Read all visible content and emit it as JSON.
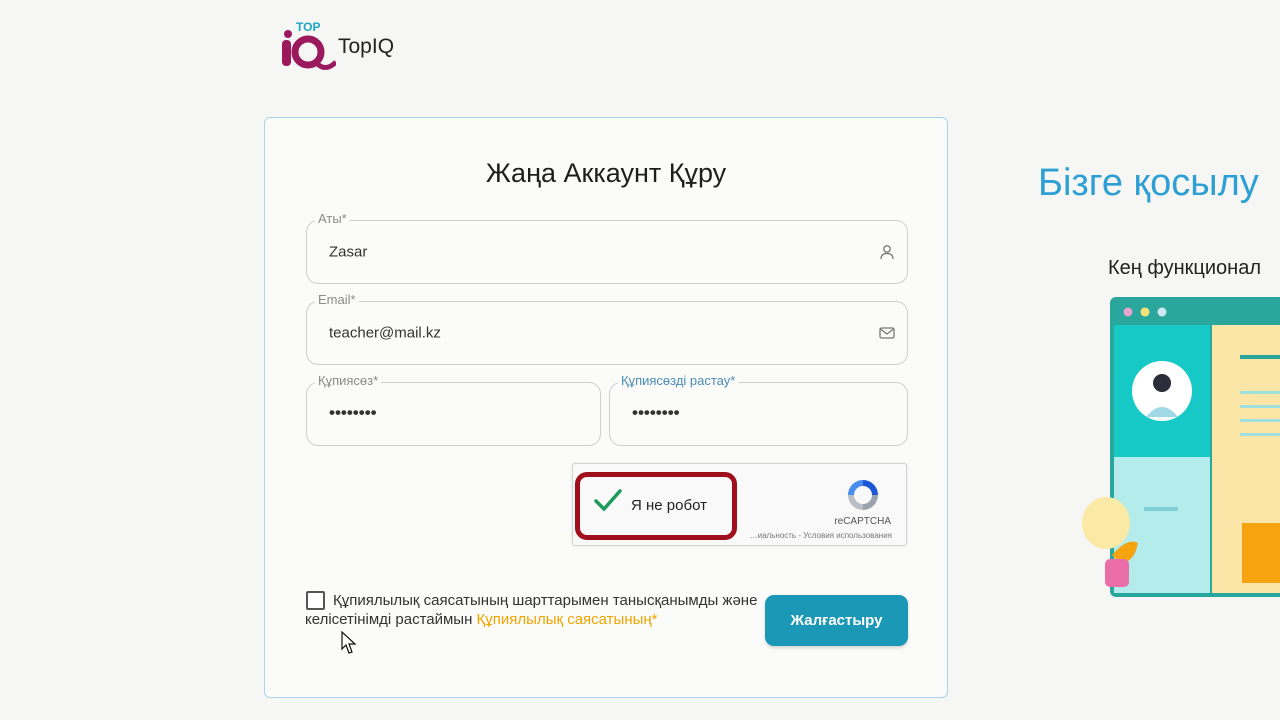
{
  "brand": {
    "name": "TopIQ",
    "logo_icon": "topiq-logo-icon",
    "accent_tag": "TOP"
  },
  "form": {
    "title": "Жаңа Аккаунт Құру",
    "name_field": {
      "label": "Аты*",
      "value": "Zasar",
      "icon": "user-icon"
    },
    "email_field": {
      "label": "Email*",
      "value": "teacher@mail.kz",
      "icon": "mail-icon"
    },
    "password_field": {
      "label": "Құпиясөз*",
      "value": "••••••••"
    },
    "confirm_field": {
      "label": "Құпиясөзді растау*",
      "value": "••••••••"
    },
    "recaptcha": {
      "label": "Я не робот",
      "brand": "reCAPTCHA",
      "terms": "…иальность - Условия использования",
      "checked": true
    },
    "consent": {
      "text": "Құпиялылық саясатының шарттарымен танысқанымды және келісетінімді растаймын",
      "link": "Құпиялылық саясатының*",
      "checked": false
    },
    "submit_label": "Жалғастыру"
  },
  "side": {
    "title": "Бізге қосылу",
    "subtitle": "Кең функционал"
  },
  "colors": {
    "accent": "#1a98b6",
    "title_blue": "#2d9fd4",
    "link_orange": "#f0a400",
    "highlight_red": "#a0101c",
    "logo_magenta": "#9b1a5e"
  }
}
